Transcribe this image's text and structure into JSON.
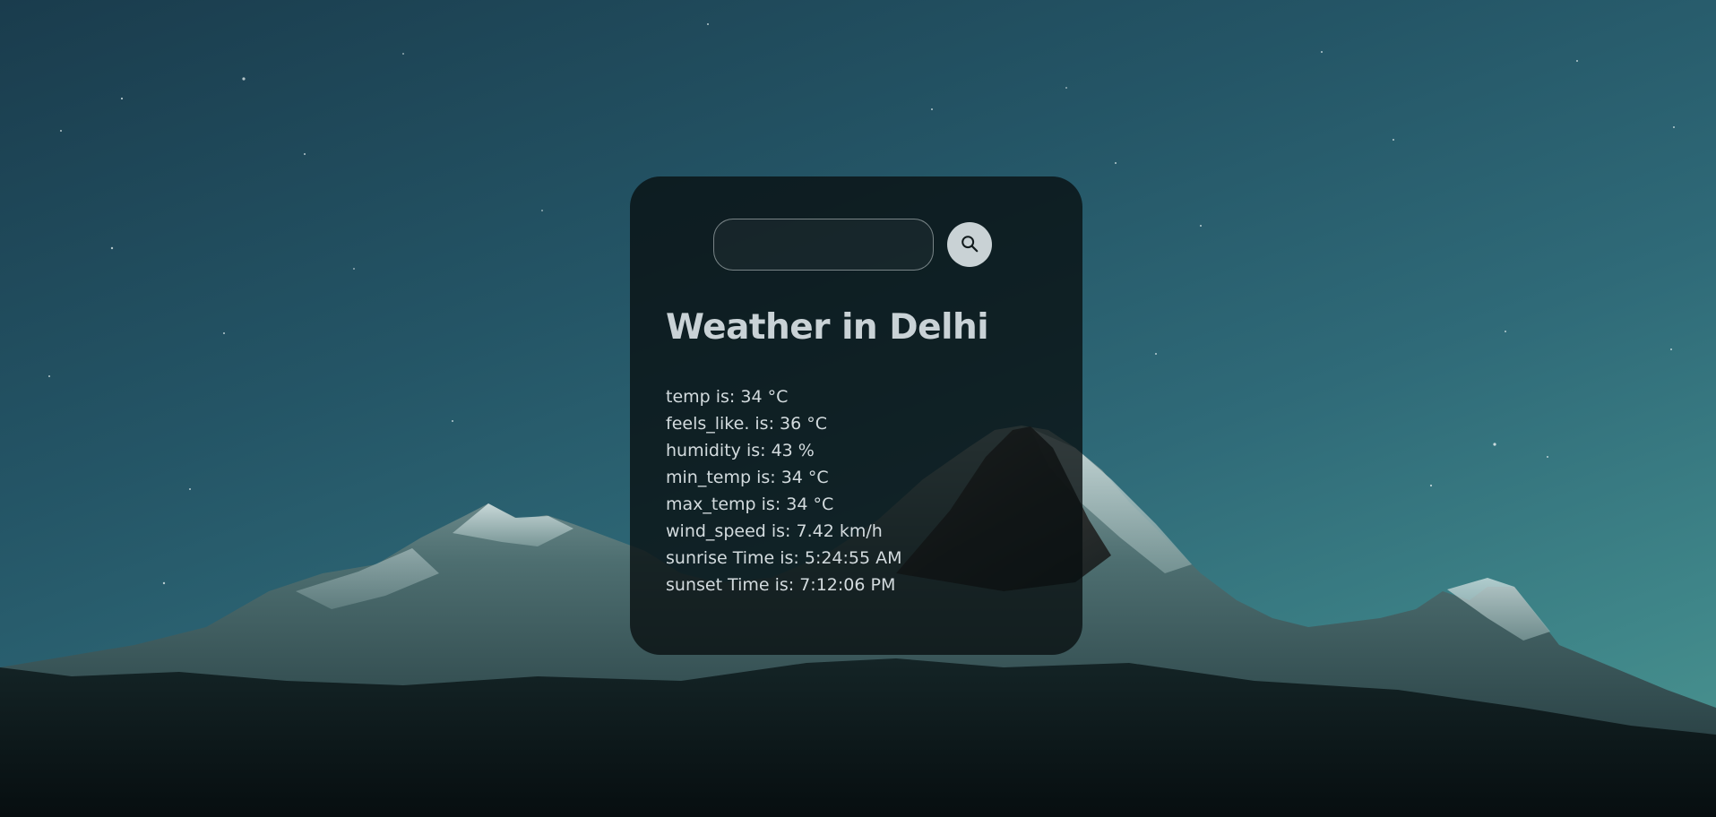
{
  "search": {
    "value": "",
    "placeholder": "",
    "button_icon": "search-icon"
  },
  "weather": {
    "title": "Weather in Delhi",
    "stats": [
      "temp is: 34 °C",
      "feels_like. is: 36 °C",
      "humidity is: 43 %",
      "min_temp is: 34 °C",
      "max_temp is: 34 °C",
      "wind_speed is: 7.42 km/h",
      "sunrise Time is: 5:24:55 AM",
      "sunset Time is: 7:12:06 PM"
    ]
  },
  "colors": {
    "card_background": "#0e1416",
    "text": "#d3dbde",
    "search_button": "#c9d2d5",
    "sky_top": "#1a3c4d",
    "sky_bottom": "#4d9690"
  }
}
